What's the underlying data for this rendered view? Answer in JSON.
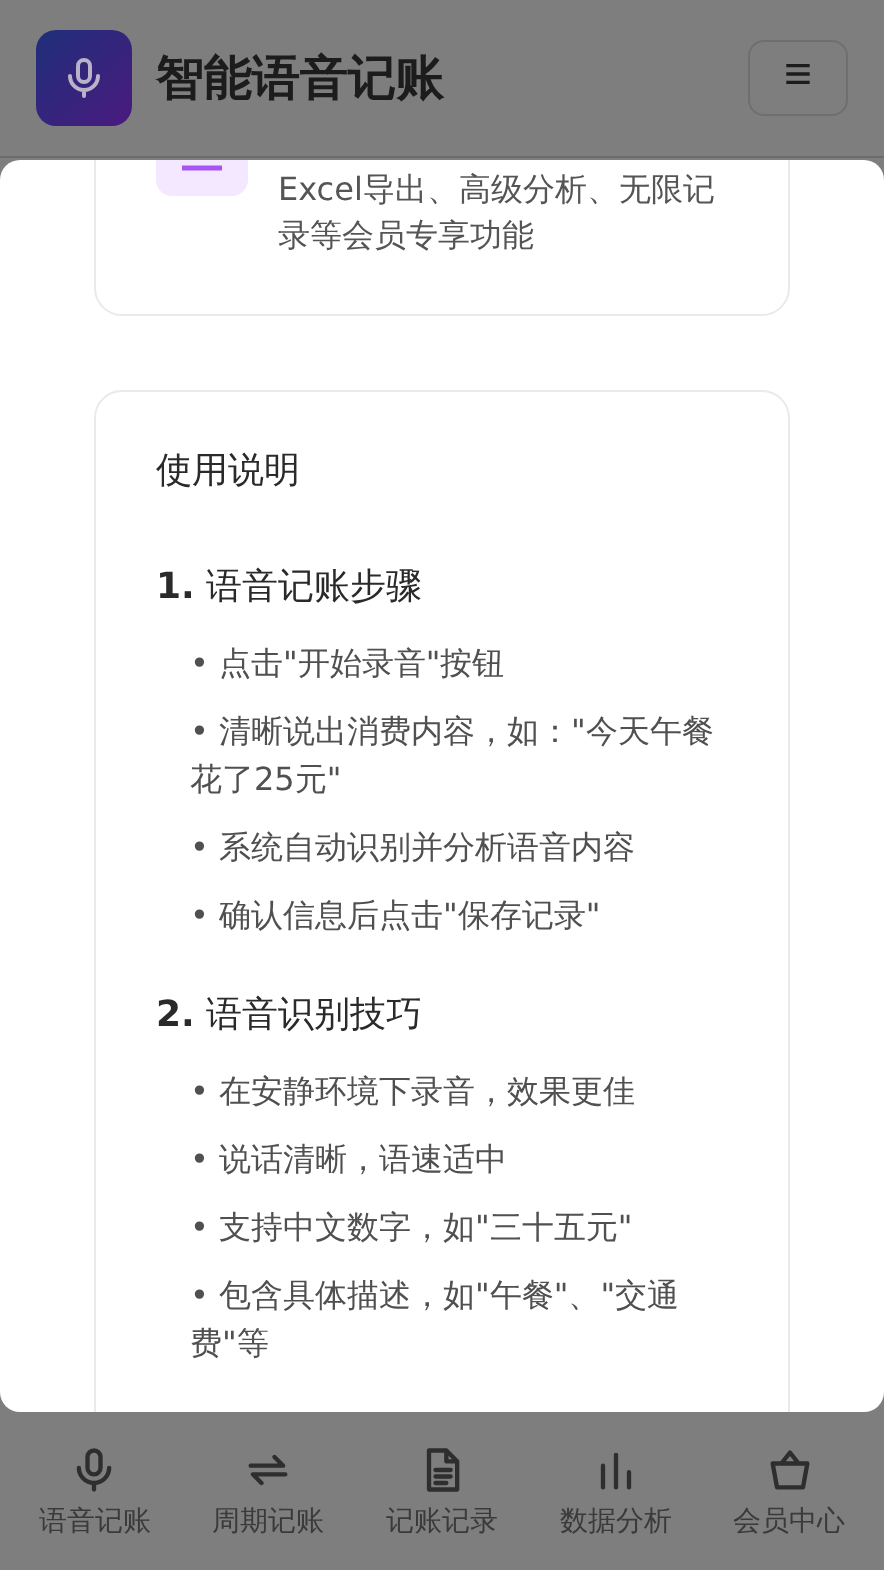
{
  "header": {
    "title": "智能语音记账"
  },
  "modal": {
    "feature_card": {
      "description": "Excel导出、高级分析、无限记录等会员专享功能"
    },
    "instructions": {
      "title": "使用说明",
      "sections": [
        {
          "heading": "**1.** 语音记账步骤",
          "items": [
            "• 点击\"开始录音\"按钮",
            "• 清晰说出消费内容，如：\"今天午餐花了25元\"",
            "• 系统自动识别并分析语音内容",
            "• 确认信息后点击\"保存记录\""
          ]
        },
        {
          "heading": "**2.** 语音识别技巧",
          "items": [
            "• 在安静环境下录音，效果更佳",
            "• 说话清晰，语速适中",
            "• 支持中文数字，如\"三十五元\"",
            "• 包含具体描述，如\"午餐\"、\"交通费\"等"
          ]
        }
      ]
    }
  },
  "bottom_nav": [
    {
      "label": "语音记账"
    },
    {
      "label": "周期记账"
    },
    {
      "label": "记账记录"
    },
    {
      "label": "数据分析"
    },
    {
      "label": "会员中心"
    }
  ]
}
